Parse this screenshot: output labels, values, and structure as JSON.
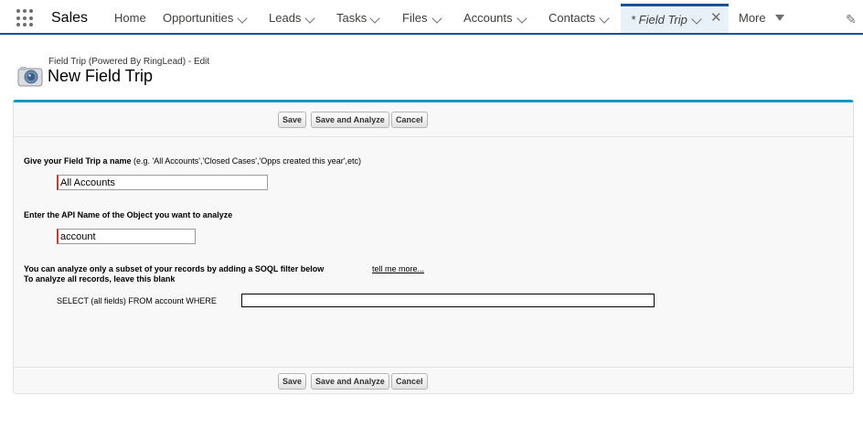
{
  "nav": {
    "app_name": "Sales",
    "items": [
      {
        "label": "Home",
        "has_dropdown": false
      },
      {
        "label": "Opportunities",
        "has_dropdown": true
      },
      {
        "label": "Leads",
        "has_dropdown": true
      },
      {
        "label": "Tasks",
        "has_dropdown": true
      },
      {
        "label": "Files",
        "has_dropdown": true
      },
      {
        "label": "Accounts",
        "has_dropdown": true
      },
      {
        "label": "Contacts",
        "has_dropdown": true
      }
    ],
    "active_tab": {
      "label": "* Field Trip"
    },
    "more_label": "More",
    "icons": [
      "app-launcher-icon",
      "chevron-down-icon",
      "close-icon",
      "caret-down-icon",
      "pencil-icon"
    ],
    "accent_color": "#1b5297"
  },
  "header": {
    "subtitle": "Field Trip (Powered By RingLead) - Edit",
    "title": "New Field Trip",
    "icon": "camera-icon"
  },
  "form": {
    "buttons": {
      "save": "Save",
      "save_analyze": "Save and Analyze",
      "cancel": "Cancel"
    },
    "name_label_bold": "Give your Field Trip a name",
    "name_label_hint": " (e.g. 'All Accounts','Closed Cases','Opps created this year',etc)",
    "name_value": "All Accounts",
    "object_label": "Enter the API Name of the Object you want to analyze",
    "object_value": "account",
    "filter_line1": "You can analyze only a subset of your records by adding a SOQL filter below",
    "filter_link": "tell me more...",
    "filter_line2": "To analyze all records, leave this blank",
    "select_prefix": "SELECT (all fields) FROM account WHERE",
    "where_value": "",
    "required_color": "#c23934",
    "panel_accent": "#1797c0"
  }
}
